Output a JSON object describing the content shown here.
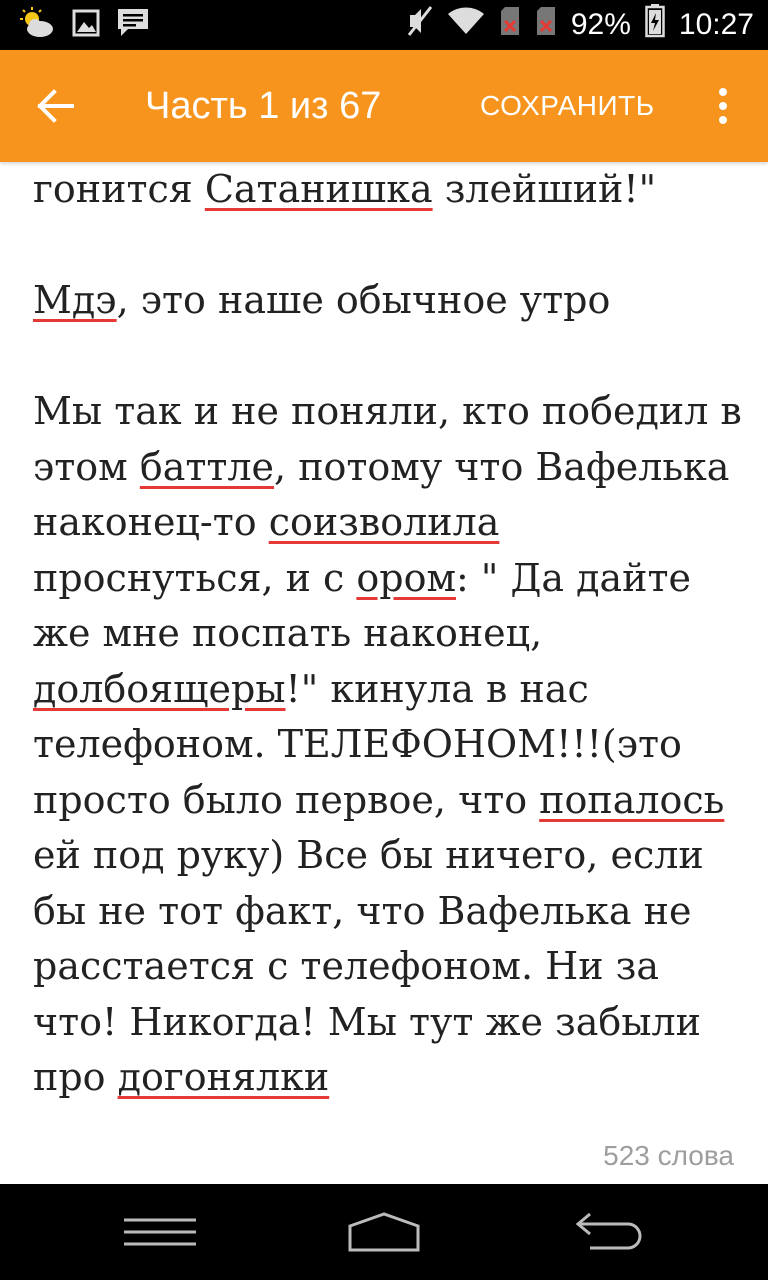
{
  "status_bar": {
    "battery": "92%",
    "time": "10:27",
    "left_icons": [
      "weather-icon",
      "image-icon",
      "message-icon"
    ],
    "right_icons": [
      "mute-icon",
      "wifi-icon",
      "sim1-no-signal-icon",
      "sim2-no-signal-icon",
      "battery-icon"
    ]
  },
  "app_bar": {
    "title": "Часть 1 из 67",
    "save_label": "СОХРАНИТЬ",
    "accent_color": "#f7941d"
  },
  "content": {
    "p0": [
      {
        "text": "гонится "
      },
      {
        "text": "Сатанишка",
        "spell": true
      },
      {
        "text": " злейший!\""
      }
    ],
    "p1": [
      {
        "text": "Мдэ",
        "spell": true
      },
      {
        "text": ", это наше обычное утро"
      }
    ],
    "p2": [
      {
        "text": "Мы так и не поняли, кто победил в этом "
      },
      {
        "text": "баттле",
        "spell": true
      },
      {
        "text": ", потому что Вафелька наконец-то "
      },
      {
        "text": "соизволила",
        "spell": true
      },
      {
        "text": " проснуться, и с "
      },
      {
        "text": "ором",
        "spell": true
      },
      {
        "text": ": \" Да дайте же мне поспать наконец, "
      },
      {
        "text": "долбоящеры",
        "spell": true
      },
      {
        "text": "!\" кинула в нас телефоном. ТЕЛЕФОНОМ!!!(это просто было первое, что "
      },
      {
        "text": "попалось",
        "spell": true
      },
      {
        "text": " ей под руку) Все бы ничего, если бы не тот факт, что Вафелька не расстается с телефоном. Ни за что! Никогда! Мы тут же забыли про "
      },
      {
        "text": "догонялки",
        "spell": true
      }
    ]
  },
  "footer": {
    "word_count": "523 слова"
  },
  "spell_underline_color": "#e53935"
}
